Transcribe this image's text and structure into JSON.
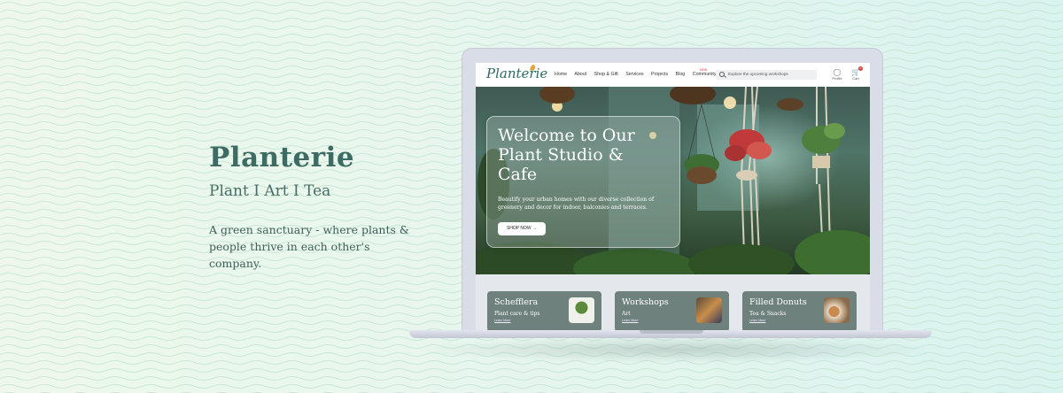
{
  "intro": {
    "brand": "Planterie",
    "tagline": "Plant I Art I Tea",
    "description": "A green sanctuary - where plants & people thrive in each other's company."
  },
  "nav": {
    "logo": "Planterie",
    "links": [
      "Home",
      "About",
      "Shop & Gift",
      "Services",
      "Projects",
      "Blog",
      "Community"
    ],
    "new_badge": "NEW",
    "search_placeholder": "Explore the upcoming workshops",
    "profile_label": "Profile",
    "cart_label": "Cart",
    "cart_count": "0"
  },
  "hero": {
    "title": "Welcome to Our Plant Studio & Cafe",
    "subtitle": "Beautify your urban homes with our diverse collection of greenery and decor for indoor, balconies and terraces.",
    "cta": "SHOP NOW"
  },
  "tiles": [
    {
      "title": "Schefflera",
      "subtitle": "Plant care & tips",
      "link": "Learn More"
    },
    {
      "title": "Workshops",
      "subtitle": "Art",
      "link": "Learn More"
    },
    {
      "title": "Filled Donuts",
      "subtitle": "Tea & Snacks",
      "link": "Learn More"
    }
  ],
  "colors": {
    "brand": "#3c6c63",
    "tile": "#6e817c",
    "cart_badge": "#d9433a",
    "logo_leaf": "#e2a53a"
  }
}
